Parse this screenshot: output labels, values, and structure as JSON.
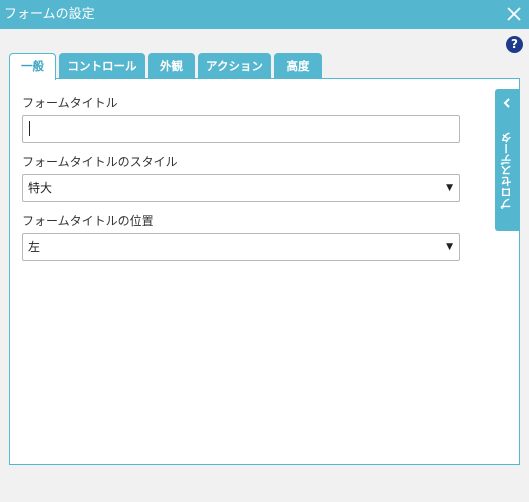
{
  "window": {
    "title": "フォームの設定",
    "help_label": "?"
  },
  "tabs": [
    {
      "label": "一般",
      "active": true
    },
    {
      "label": "コントロール",
      "active": false
    },
    {
      "label": "外観",
      "active": false
    },
    {
      "label": "アクション",
      "active": false
    },
    {
      "label": "高度",
      "active": false
    }
  ],
  "form": {
    "title_label": "フォームタイトル",
    "title_value": "",
    "style_label": "フォームタイトルのスタイル",
    "style_value": "特大",
    "position_label": "フォームタイトルの位置",
    "position_value": "左"
  },
  "side_panel": {
    "label": "プロセスデータ"
  },
  "colors": {
    "accent": "#55b6cf",
    "help": "#1e3a8c"
  }
}
